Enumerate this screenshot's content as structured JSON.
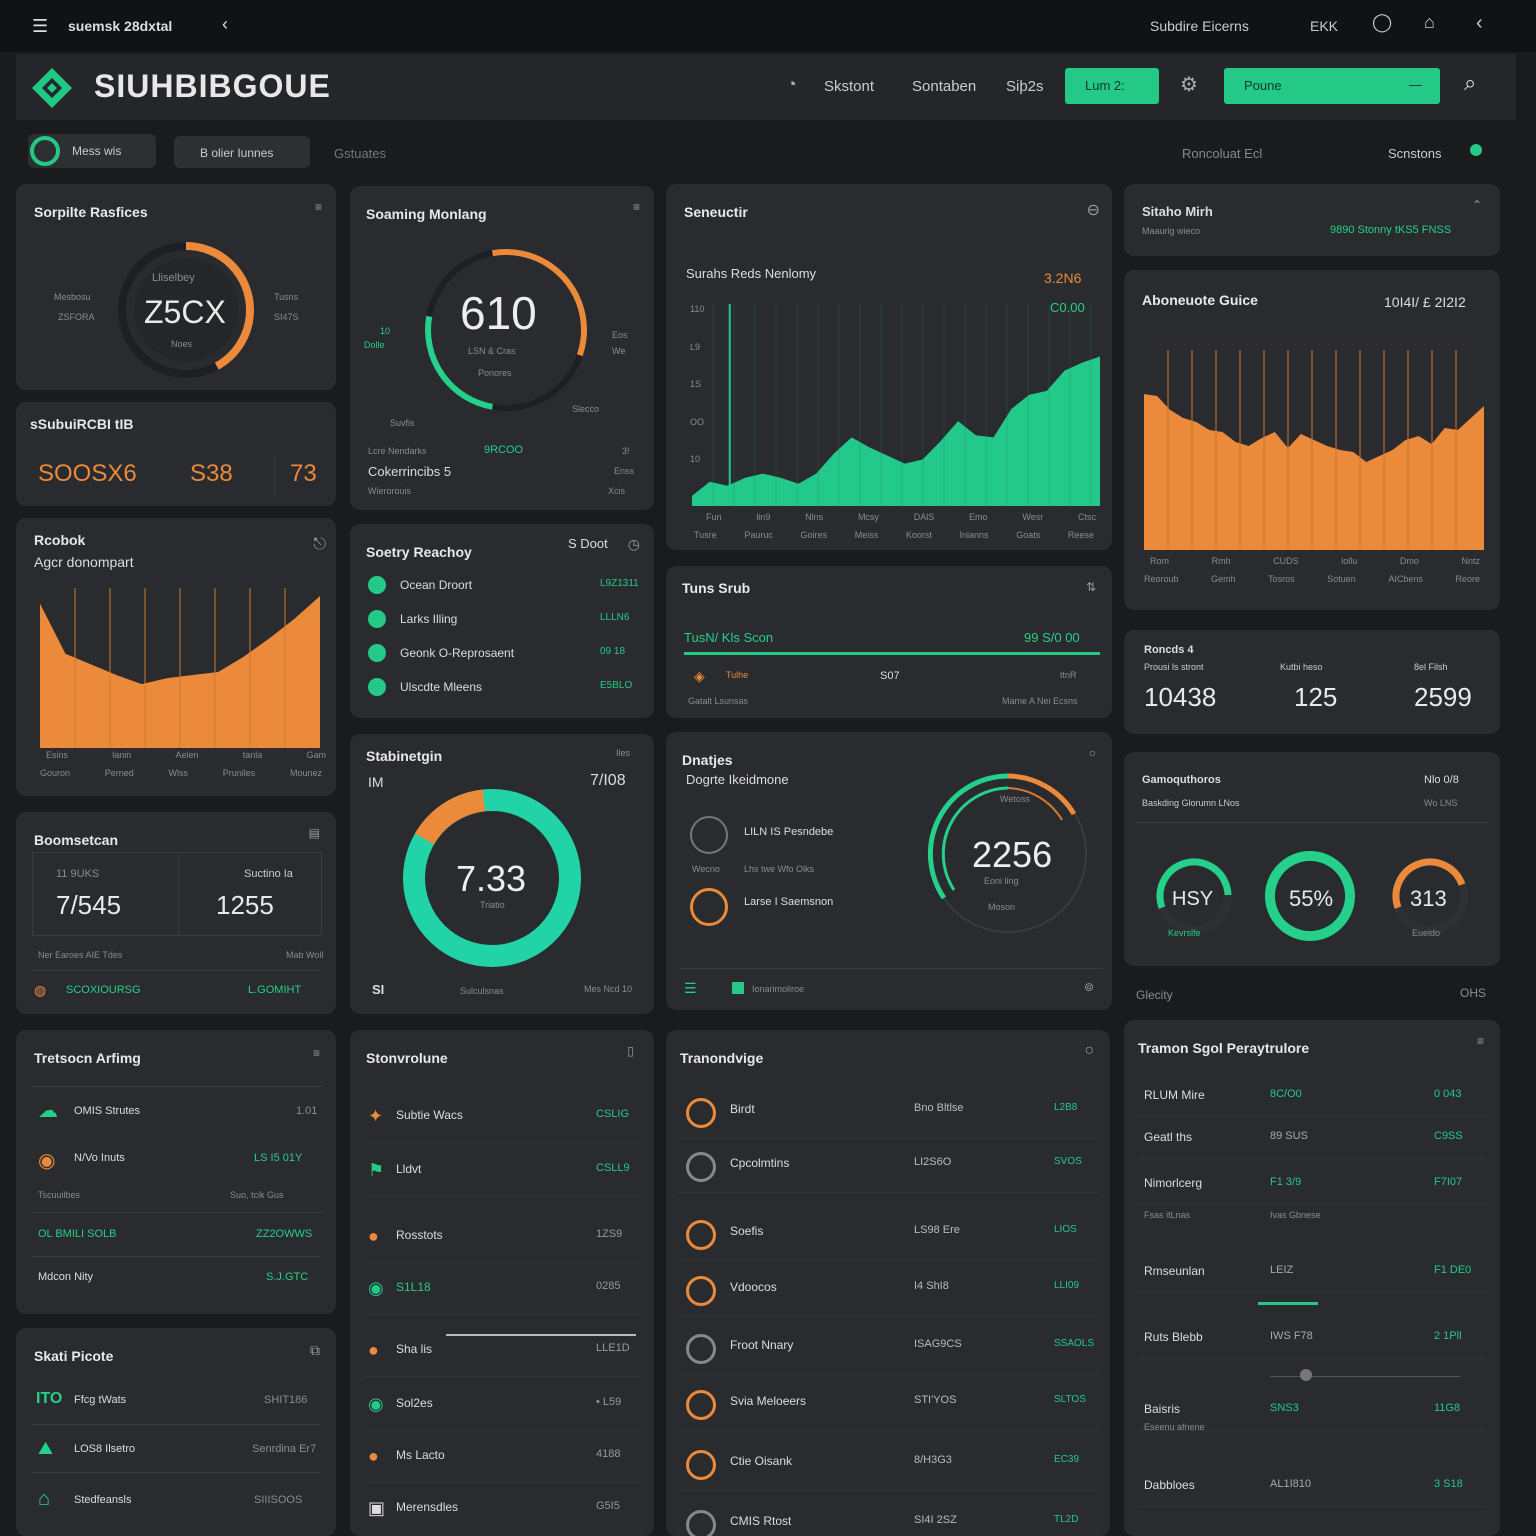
{
  "topbar": {
    "app_label": "suemsk 28dxtal",
    "right_title": "Subdire Eicerns",
    "right_code": "EKK"
  },
  "header": {
    "brand": "SIUHBIBGOUE",
    "nav": [
      "Skstont",
      "Sontaben",
      "Siþ2s"
    ],
    "cta_small": "Lum 2:",
    "cta_wide": "Poune",
    "cta_wide_trail": "—"
  },
  "subheader": {
    "pill1": "Mess wis",
    "pill2": "B olier Iunnes",
    "link": "Gstuates",
    "center": "Roncoluat Ecl",
    "right": "Scnstons"
  },
  "card1": {
    "title": "Sorpilte Rasfices",
    "top": "Lliselbey",
    "value": "Z5CX",
    "sub": "Noes",
    "left_a": "Mesbosu",
    "left_b": "ZSFORA",
    "right_a": "Tusns",
    "right_b": "SI47S",
    "progress": 0.42
  },
  "card2": {
    "title": "sSubuiRCBI tIB",
    "values": [
      "SOOSX6",
      "S38",
      "73"
    ]
  },
  "card3": {
    "title": "Rcobok",
    "subtitle": "Agcr donompart",
    "xlabels_a": [
      "Esins",
      "lanin",
      "Aelen",
      "tanla",
      "Gam"
    ],
    "xlabels_b": [
      "Gouron",
      "Perned",
      "Wlss",
      "Pruniles",
      "Mounez"
    ]
  },
  "card4": {
    "title": "Boomsetcan",
    "cell1_label": "11 9UKS",
    "cell1_value": "7/545",
    "cell2_label": "Suctino Ia",
    "cell2_value": "1255",
    "row_a": "Ner Earoes AIE Tdes",
    "row_a_right": "Mab Woll",
    "row_b": "SCOXIOURSG",
    "row_b_right": "L.GOMIHT"
  },
  "card5": {
    "title": "Tretsocn Arfimg",
    "items": [
      {
        "label": "OMIS Strutes",
        "value": "1.01"
      },
      {
        "label": "N/Vo Inuts",
        "value": "LS I5 01Y"
      }
    ],
    "subrow_left": "Tscuuilbes",
    "subrow_right": "Suo, tcik Gus",
    "green_left": "OL BMILI SOLB",
    "green_right": "ZZ2OWWS",
    "last_left": "Mdcon Nity",
    "last_right": "S.J.GTC"
  },
  "card6": {
    "title": "Skati Picote",
    "items": [
      {
        "label": "Ffcg tWats",
        "value": "SHIT186"
      },
      {
        "label": "LOS8 Ilsetro",
        "value": "Senrdina Er7"
      },
      {
        "label": "Stedfeansls",
        "value": "SIIISOOS"
      }
    ]
  },
  "gauge610": {
    "title": "Soaming Monlang",
    "value": "610",
    "sub1": "LSN & Cras",
    "sub2": "Ponores",
    "left_a": "10",
    "left_b": "Dolle",
    "right_a": "Eos",
    "right_b": "We",
    "label_bottom_left": "Suvfis",
    "label_bottom_right": "Slecco",
    "row1_left": "Lcre Nendarks",
    "row1_mid": "9RCOO",
    "row1_right": "3!",
    "row2_left": "Cokerrincibs 5",
    "row2_right": "Enss",
    "row3_left": "Wierorouis",
    "row3_right": "Xcis",
    "progress_orange": 0.33,
    "progress_green": 0.25
  },
  "ready": {
    "title": "Soetry Reachoy",
    "right_label": "S Doot",
    "items": [
      {
        "label": "Ocean Droort",
        "value": "L9Z1311"
      },
      {
        "label": "Larks Illing",
        "value": "LLLN6"
      },
      {
        "label": "Geonk O-Reprosaent",
        "value": "09 18"
      },
      {
        "label": "Ulscdte Mleens",
        "value": "E5BLO"
      }
    ]
  },
  "donut733": {
    "title": "Stabinetgin",
    "top_left": "IM",
    "top_right": "7/I08",
    "value": "7.33",
    "sub": "Triatio",
    "bottom_left": "SI",
    "bottom_mid": "Sulculsnas",
    "bottom_right": "Mes Ncd 10",
    "orange_fraction": 0.15
  },
  "services": {
    "title": "Stonvrolune",
    "items": [
      {
        "label": "Subtie Wacs",
        "value": "CSLIG"
      },
      {
        "label": "Lldvt",
        "value": "CSLL9"
      },
      {
        "label": "Rosstots",
        "value": "1ZS9"
      },
      {
        "label": "S1L18",
        "value": "0285"
      },
      {
        "label": "Sha lis",
        "value": "LLE1D"
      },
      {
        "label": "Sol2es",
        "value": "• L59"
      },
      {
        "label": "Ms Lacto",
        "value": "4188"
      },
      {
        "label": "Merensdles",
        "value": "G5I5"
      }
    ]
  },
  "mainchart": {
    "title": "Seneuctir",
    "subtitle": "Surahs Reds Nenlomy",
    "right_orange": "3.2N6",
    "right_green": "C0.00",
    "ylabels": [
      "110",
      "L9",
      "1S",
      "OO",
      "10"
    ],
    "xlabels_a": [
      "Fun",
      "lin9",
      "Nlns",
      "Mcsy",
      "DAlS",
      "Emo",
      "Wesr",
      "Ctsc"
    ],
    "xlabels_b": [
      "Tusre",
      "Pauruc",
      "Goires",
      "Meiss",
      "Koorst",
      "Inianns",
      "Goats",
      "Reese"
    ],
    "values": [
      0.05,
      0.12,
      0.1,
      0.14,
      0.16,
      0.14,
      0.11,
      0.16,
      0.26,
      0.34,
      0.29,
      0.25,
      0.21,
      0.23,
      0.32,
      0.42,
      0.35,
      0.34,
      0.48,
      0.55,
      0.57,
      0.67,
      0.71,
      0.74
    ],
    "spike_index": 1,
    "spike_value": 1.0
  },
  "tuna": {
    "title": "Tuns Srub",
    "row_left": "TusN/ Kls Scon",
    "row_right": "99 S/0 00",
    "item_label": "Tulhe",
    "item_mid": "S07",
    "item_right": "ttnR",
    "foot_left": "Gatalt Lsunsas",
    "foot_right": "Mame A Nei Ecsns"
  },
  "deposits": {
    "title": "Dnatjes",
    "subtitle": "Dogrte Ikeidmone",
    "items": [
      "LILN IS Pesndebe",
      "Lhs twe Wfo Olks",
      "Larse I Saemsnon"
    ],
    "left_mid": "Wecno",
    "value": "2256",
    "sub1": "Eoni ling",
    "sub2": "Moson",
    "top_small": "Wetoss",
    "footer": "Ionarimoliroe"
  },
  "topright": {
    "title": "Sitaho Mirh",
    "sub": "Maaurig wieco",
    "green": "9890 Stonny tKS5 FNSS"
  },
  "orangechart": {
    "title": "Aboneuote Guice",
    "right": "10I4I/ £ 2I2I2",
    "values": [
      0.78,
      0.77,
      0.7,
      0.66,
      0.64,
      0.6,
      0.59,
      0.54,
      0.52,
      0.56,
      0.59,
      0.51,
      0.58,
      0.55,
      0.52,
      0.5,
      0.49,
      0.44,
      0.47,
      0.5,
      0.55,
      0.57,
      0.53,
      0.61,
      0.6,
      0.66,
      0.72
    ],
    "xlabels_a": [
      "Rom",
      "Rmh",
      "CUDS",
      "lollu",
      "Dmo",
      "Nntz"
    ],
    "xlabels_b": [
      "Reoroub",
      "Gemh",
      "Tosros",
      "Sotuen",
      "AICbens",
      "Reore"
    ]
  },
  "stats": {
    "title": "Roncds 4",
    "cols": [
      {
        "label": "Prousi ls stront",
        "value": "10438"
      },
      {
        "label": "Kutbi heso",
        "value": "125"
      },
      {
        "label": "8el Filsh",
        "value": "2599"
      }
    ]
  },
  "gauges3": {
    "title": "Gamoquthoros",
    "subtitle": "Baskding Glorumn LNos",
    "right_a": "Nlo 0/8",
    "right_b": "Wo LNS",
    "items": [
      {
        "value": "HSY",
        "label": "Kevrslfe",
        "fraction": 0.55
      },
      {
        "value": "55%",
        "label": "",
        "fraction": 1.0
      },
      {
        "value": "313",
        "label": "Eueido",
        "fraction": 0.5
      }
    ],
    "footer_left": "Glecity",
    "footer_right": "OHS"
  },
  "refitems": {
    "title": "Tranondvige",
    "items": [
      {
        "label": "Birdt",
        "mid": "Bno Bltlse",
        "value": "L2B8"
      },
      {
        "label": "Cpcolmtins",
        "mid": "LI2S6O",
        "value": "SVOS"
      },
      {
        "label": "Soefis",
        "mid": "LS98 Ere",
        "value": "LIOS"
      },
      {
        "label": "Vdoocos",
        "mid": "I4 ShI8",
        "value": "LLI09"
      },
      {
        "label": "Froot Nnary",
        "mid": "ISAG9CS",
        "value": "SSAOLS"
      },
      {
        "label": "Svia Meloeers",
        "mid": "STI'YOS",
        "value": "SLTOS"
      },
      {
        "label": "Ctie Oisank",
        "mid": "8/H3G3",
        "value": "EC39"
      },
      {
        "label": "CMIS Rtost",
        "mid": "SI4I 2SZ",
        "value": "TL2D"
      }
    ]
  },
  "perf": {
    "title": "Tramon Sgol Peraytrulore",
    "rows": [
      {
        "label": "RLUM Mire",
        "mid": "8C/O0",
        "value": "0 043"
      },
      {
        "label": "Geatl ths",
        "mid": "89 SUS",
        "value": "C9SS"
      },
      {
        "label": "Nimorlcerg",
        "mid": "F1 3/9",
        "value": "F7I07"
      },
      {
        "label": "Rmseunlan",
        "mid": "LEIZ",
        "value": "F1 DE0"
      },
      {
        "label": "Ruts Blebb",
        "mid": "IWS F78",
        "value": "2 1Pll"
      },
      {
        "label": "Baisris",
        "mid": "SNS3",
        "value": "11G8"
      },
      {
        "label": "Dabbloes",
        "mid": "AL1I810",
        "value": "3 S18"
      }
    ],
    "sub1_left": "Fsas itLnas",
    "sub1_right": "Ivas Gbnese",
    "sub2": "Eseenu afnene"
  }
}
